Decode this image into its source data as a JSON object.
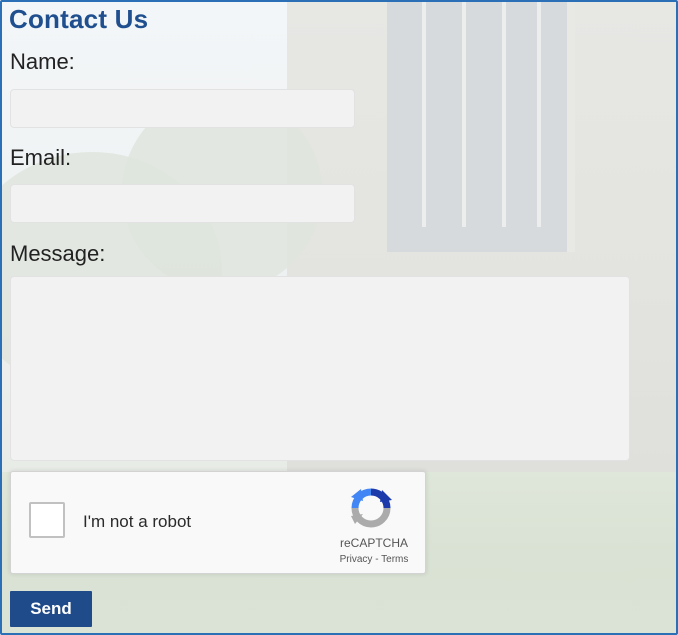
{
  "form": {
    "title": "Contact Us",
    "name_label": "Name:",
    "name_value": "",
    "email_label": "Email:",
    "email_value": "",
    "message_label": "Message:",
    "message_value": "",
    "send_label": "Send"
  },
  "recaptcha": {
    "checkbox_label": "I'm not a robot",
    "checked": false,
    "brand": "reCAPTCHA",
    "privacy_label": "Privacy",
    "separator": " - ",
    "terms_label": "Terms",
    "logo_icon": "recaptcha-logo-icon"
  },
  "colors": {
    "accent": "#1f4b8a",
    "title": "#1f4f8f",
    "frame_border": "#2b6fb6",
    "field_bg": "#f2f2f2"
  }
}
